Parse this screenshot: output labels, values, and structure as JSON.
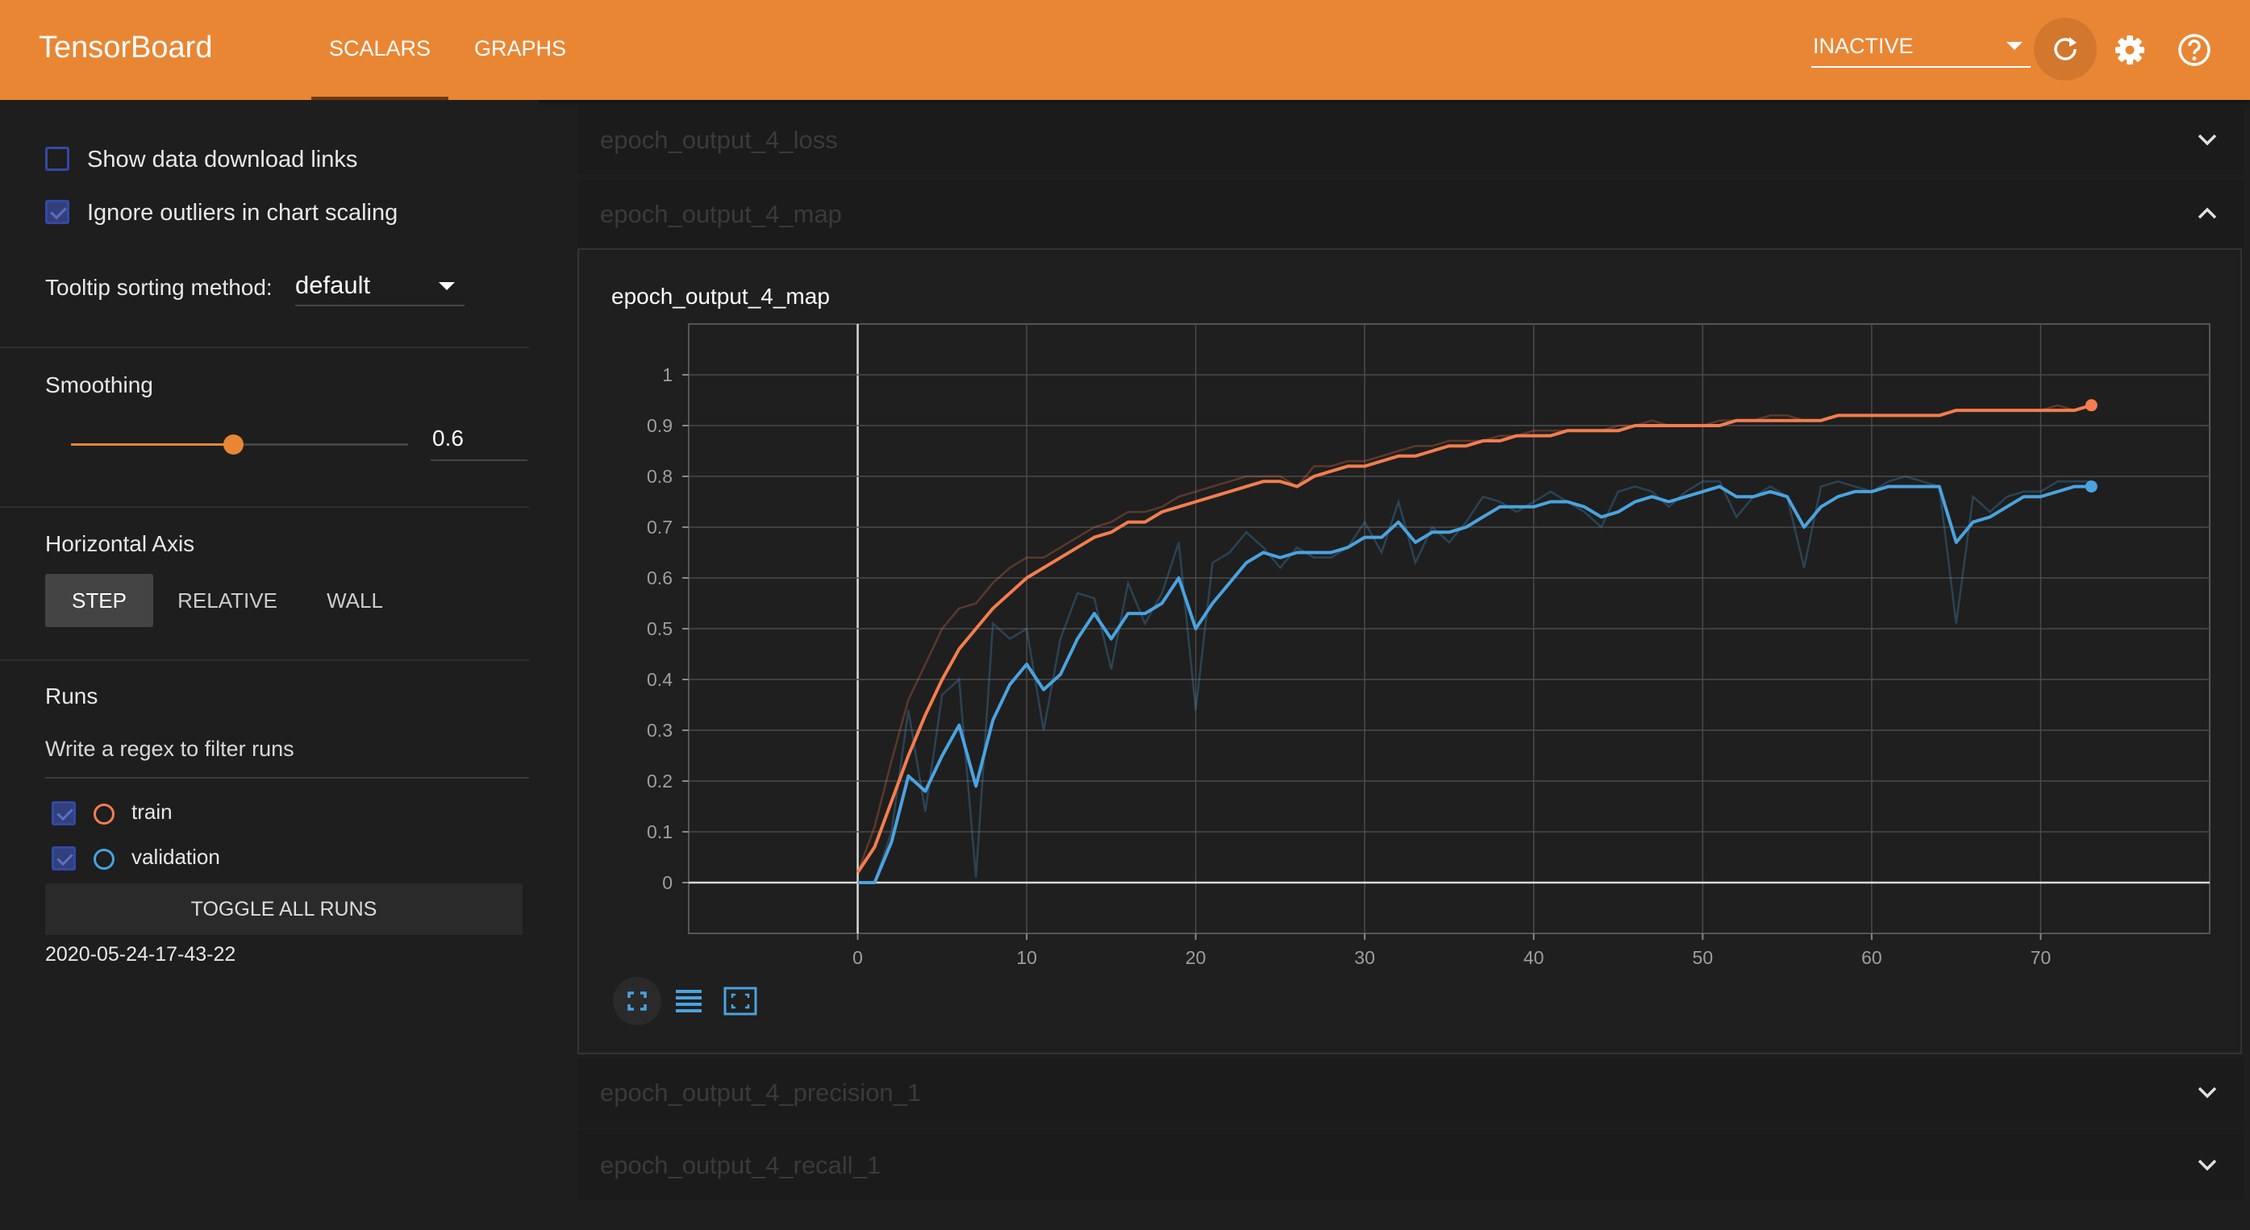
{
  "header": {
    "brand": "TensorBoard",
    "tabs": [
      {
        "label": "SCALARS",
        "active": true
      },
      {
        "label": "GRAPHS",
        "active": false
      }
    ],
    "status_select": "INACTIVE",
    "icons": [
      "reload-icon",
      "settings-icon",
      "help-icon"
    ],
    "color": "#e98634"
  },
  "sidebar": {
    "show_download_links": {
      "label": "Show data download links",
      "checked": false
    },
    "ignore_outliers": {
      "label": "Ignore outliers in chart scaling",
      "checked": true
    },
    "tooltip_sort": {
      "label": "Tooltip sorting method:",
      "value": "default"
    },
    "smoothing": {
      "label": "Smoothing",
      "value": "0.6",
      "fraction": 0.6
    },
    "horizontal_axis": {
      "label": "Horizontal Axis",
      "options": [
        "STEP",
        "RELATIVE",
        "WALL"
      ],
      "selected": "STEP"
    },
    "runs": {
      "label": "Runs",
      "filter_placeholder": "Write a regex to filter runs",
      "items": [
        {
          "name": "train",
          "checked": true,
          "color": "#f47d4e"
        },
        {
          "name": "validation",
          "checked": true,
          "color": "#4aa3df"
        }
      ],
      "toggle_label": "TOGGLE ALL RUNS",
      "log_dir": "2020-05-24-17-43-22"
    }
  },
  "sections": {
    "loss": {
      "title": "epoch_output_4_loss",
      "expanded": false
    },
    "map": {
      "title": "epoch_output_4_map",
      "expanded": true
    },
    "precision": {
      "title": "epoch_output_4_precision_1",
      "expanded": false
    },
    "recall": {
      "title": "epoch_output_4_recall_1",
      "expanded": false
    }
  },
  "card": {
    "title": "epoch_output_4_map",
    "toolbar_icons": [
      "fit-to-data-icon",
      "log-scale-icon",
      "reset-zoom-icon"
    ]
  },
  "chart_data": {
    "type": "line",
    "title": "epoch_output_4_map",
    "xlim": [
      -10,
      80
    ],
    "ylim": [
      -0.1,
      1.1
    ],
    "x_ticks": [
      0,
      10,
      20,
      30,
      40,
      50,
      60,
      70
    ],
    "y_ticks": [
      0,
      0.1,
      0.2,
      0.3,
      0.4,
      0.5,
      0.6,
      0.7,
      0.8,
      0.9,
      1
    ],
    "grid": true,
    "x": [
      0,
      1,
      2,
      3,
      4,
      5,
      6,
      7,
      8,
      9,
      10,
      11,
      12,
      13,
      14,
      15,
      16,
      17,
      18,
      19,
      20,
      21,
      22,
      23,
      24,
      25,
      26,
      27,
      28,
      29,
      30,
      31,
      32,
      33,
      34,
      35,
      36,
      37,
      38,
      39,
      40,
      41,
      42,
      43,
      44,
      45,
      46,
      47,
      48,
      49,
      50,
      51,
      52,
      53,
      54,
      55,
      56,
      57,
      58,
      59,
      60,
      61,
      62,
      63,
      64,
      65,
      66,
      67,
      68,
      69,
      70,
      71,
      72,
      73
    ],
    "series": [
      {
        "name": "train",
        "color": "#f47d4e",
        "raw": [
          0.02,
          0.11,
          0.24,
          0.36,
          0.43,
          0.5,
          0.54,
          0.55,
          0.59,
          0.62,
          0.64,
          0.64,
          0.66,
          0.68,
          0.7,
          0.71,
          0.73,
          0.73,
          0.74,
          0.76,
          0.77,
          0.78,
          0.79,
          0.8,
          0.8,
          0.8,
          0.78,
          0.82,
          0.82,
          0.83,
          0.83,
          0.84,
          0.85,
          0.86,
          0.86,
          0.87,
          0.87,
          0.87,
          0.88,
          0.88,
          0.89,
          0.89,
          0.89,
          0.89,
          0.89,
          0.9,
          0.9,
          0.91,
          0.9,
          0.9,
          0.9,
          0.91,
          0.91,
          0.91,
          0.92,
          0.92,
          0.91,
          0.91,
          0.92,
          0.92,
          0.92,
          0.92,
          0.92,
          0.92,
          0.92,
          0.93,
          0.93,
          0.93,
          0.93,
          0.93,
          0.93,
          0.94,
          0.93,
          0.94
        ],
        "smoothed": [
          0.02,
          0.07,
          0.16,
          0.25,
          0.33,
          0.4,
          0.46,
          0.5,
          0.54,
          0.57,
          0.6,
          0.62,
          0.64,
          0.66,
          0.68,
          0.69,
          0.71,
          0.71,
          0.73,
          0.74,
          0.75,
          0.76,
          0.77,
          0.78,
          0.79,
          0.79,
          0.78,
          0.8,
          0.81,
          0.82,
          0.82,
          0.83,
          0.84,
          0.84,
          0.85,
          0.86,
          0.86,
          0.87,
          0.87,
          0.88,
          0.88,
          0.88,
          0.89,
          0.89,
          0.89,
          0.89,
          0.9,
          0.9,
          0.9,
          0.9,
          0.9,
          0.9,
          0.91,
          0.91,
          0.91,
          0.91,
          0.91,
          0.91,
          0.92,
          0.92,
          0.92,
          0.92,
          0.92,
          0.92,
          0.92,
          0.93,
          0.93,
          0.93,
          0.93,
          0.93,
          0.93,
          0.93,
          0.93,
          0.94
        ]
      },
      {
        "name": "validation",
        "color": "#4aa3df",
        "raw": [
          0,
          0,
          0.1,
          0.34,
          0.14,
          0.37,
          0.4,
          0.01,
          0.51,
          0.48,
          0.5,
          0.3,
          0.48,
          0.57,
          0.56,
          0.42,
          0.59,
          0.51,
          0.57,
          0.67,
          0.34,
          0.63,
          0.65,
          0.69,
          0.66,
          0.62,
          0.66,
          0.64,
          0.64,
          0.66,
          0.71,
          0.65,
          0.75,
          0.63,
          0.7,
          0.67,
          0.71,
          0.76,
          0.75,
          0.73,
          0.75,
          0.77,
          0.75,
          0.73,
          0.7,
          0.77,
          0.78,
          0.77,
          0.74,
          0.77,
          0.79,
          0.79,
          0.72,
          0.76,
          0.78,
          0.76,
          0.62,
          0.78,
          0.79,
          0.78,
          0.77,
          0.79,
          0.8,
          0.79,
          0.78,
          0.51,
          0.76,
          0.73,
          0.76,
          0.77,
          0.77,
          0.79,
          0.79,
          0.79
        ],
        "smoothed": [
          0,
          0,
          0.08,
          0.21,
          0.18,
          0.25,
          0.31,
          0.19,
          0.32,
          0.39,
          0.43,
          0.38,
          0.41,
          0.48,
          0.53,
          0.48,
          0.53,
          0.53,
          0.55,
          0.6,
          0.5,
          0.55,
          0.59,
          0.63,
          0.65,
          0.64,
          0.65,
          0.65,
          0.65,
          0.66,
          0.68,
          0.68,
          0.71,
          0.67,
          0.69,
          0.69,
          0.7,
          0.72,
          0.74,
          0.74,
          0.74,
          0.75,
          0.75,
          0.74,
          0.72,
          0.73,
          0.75,
          0.76,
          0.75,
          0.76,
          0.77,
          0.78,
          0.76,
          0.76,
          0.77,
          0.76,
          0.7,
          0.74,
          0.76,
          0.77,
          0.77,
          0.78,
          0.78,
          0.78,
          0.78,
          0.67,
          0.71,
          0.72,
          0.74,
          0.76,
          0.76,
          0.77,
          0.78,
          0.78
        ]
      }
    ]
  }
}
